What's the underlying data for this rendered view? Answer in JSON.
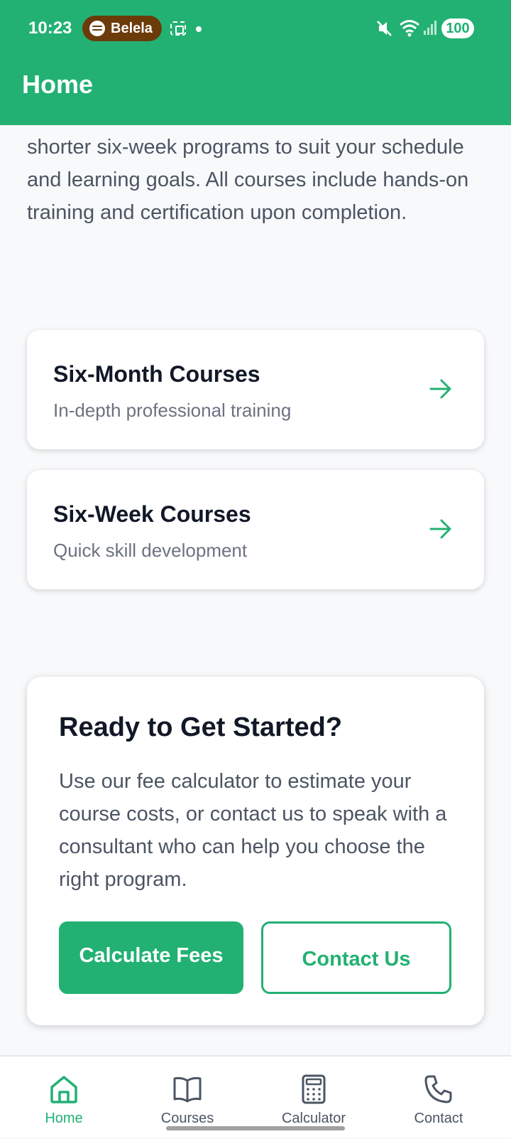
{
  "status_bar": {
    "time": "10:23",
    "media_app": "Belela",
    "battery": "100"
  },
  "app_bar": {
    "title": "Home"
  },
  "intro": {
    "text": "We offer both intensive six-month courses and shorter six-week programs to suit your schedule and learning goals. All courses include hands-on training and certification upon completion."
  },
  "courses": [
    {
      "title": "Six-Month Courses",
      "subtitle": "In-depth professional training"
    },
    {
      "title": "Six-Week Courses",
      "subtitle": "Quick skill development"
    }
  ],
  "cta": {
    "title": "Ready to Get Started?",
    "body": "Use our fee calculator to estimate your course costs, or contact us to speak with a consultant who can help you choose the right program.",
    "primary_button": "Calculate Fees",
    "secondary_button": "Contact Us"
  },
  "bottom_nav": {
    "items": [
      {
        "label": "Home",
        "icon": "home-icon",
        "active": true
      },
      {
        "label": "Courses",
        "icon": "book-icon",
        "active": false
      },
      {
        "label": "Calculator",
        "icon": "calculator-icon",
        "active": false
      },
      {
        "label": "Contact",
        "icon": "phone-icon",
        "active": false
      }
    ]
  },
  "colors": {
    "primary": "#22b173",
    "text_dark": "#111827",
    "text_muted": "#6b7280",
    "background": "#f8f9fa"
  }
}
